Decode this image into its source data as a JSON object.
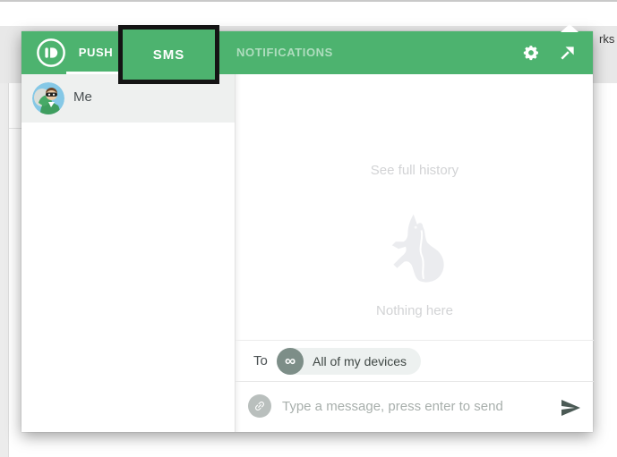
{
  "browser": {
    "page_text_fragment": "rks",
    "icons": {
      "star": "★"
    }
  },
  "popup": {
    "header": {
      "tabs": [
        {
          "label": "PUSH",
          "active": true
        },
        {
          "label": "SMS",
          "active": false
        },
        {
          "label": "NOTIFICATIONS",
          "active": false
        }
      ]
    },
    "sidebar": {
      "conversations": [
        {
          "name": "Me",
          "selected": true
        }
      ]
    },
    "main": {
      "history_link": "See full history",
      "empty_text": "Nothing here"
    },
    "compose": {
      "to_label": "To",
      "recipient": "All of my devices",
      "infinity_symbol": "∞",
      "message_placeholder": "Type a message, press enter to send"
    }
  },
  "annotation": {
    "label": "SMS"
  },
  "colors": {
    "header_green": "#4db36f",
    "toolbar_icon_green": "#3fb46a",
    "annotation_border": "#141414",
    "selected_row": "#eef0ef",
    "muted_text": "#d2d3d5",
    "pill_background": "#edf1f0",
    "pill_circle": "#7d8e88",
    "send_icon": "#4b5a55"
  }
}
